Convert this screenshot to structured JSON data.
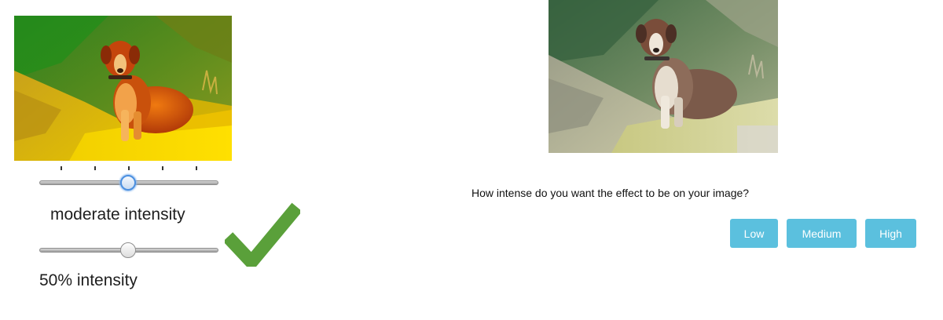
{
  "left_panel": {
    "moderate_caption": "moderate intensity",
    "percent_caption": "50% intensity",
    "moderate_slider_level": 0.5,
    "percent_slider_level": 0.5,
    "moderate_slider_tick_count": 5,
    "check_color": "#5aa03a",
    "photo_icon": "dog-photo-saturated"
  },
  "right_panel": {
    "question": "How intense do you want the effect to be on your image?",
    "buttons": [
      "Low",
      "Medium",
      "High"
    ],
    "button_color": "#5bc0de",
    "photo_icon": "dog-photo-faded"
  }
}
